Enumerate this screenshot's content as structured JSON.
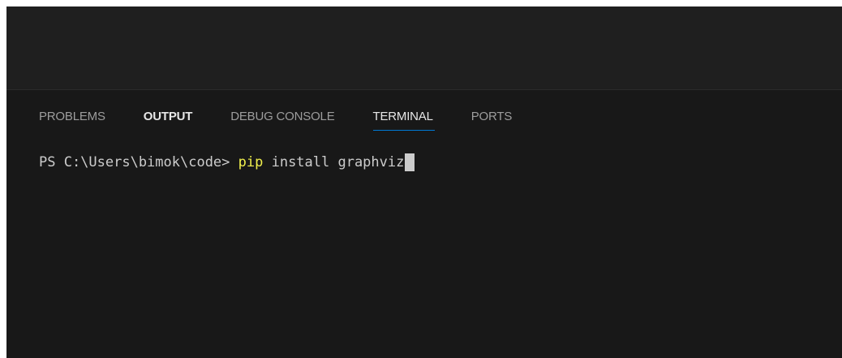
{
  "panel": {
    "tabs": [
      {
        "label": "PROBLEMS"
      },
      {
        "label": "OUTPUT"
      },
      {
        "label": "DEBUG CONSOLE"
      },
      {
        "label": "TERMINAL"
      },
      {
        "label": "PORTS"
      }
    ],
    "active_tab": "TERMINAL"
  },
  "terminal": {
    "prompt": "PS C:\\Users\\bimok\\code> ",
    "command": "pip",
    "args": " install graphviz"
  },
  "colors": {
    "background": "#181818",
    "editor_background": "#1f1f1f",
    "active_tab_underline": "#0078d4",
    "command_highlight": "#f1f04d",
    "text": "#cccccc"
  }
}
